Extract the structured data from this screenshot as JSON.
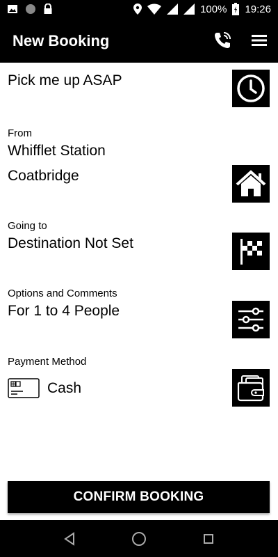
{
  "status": {
    "battery": "100%",
    "time": "19:26"
  },
  "header": {
    "title": "New Booking"
  },
  "pickup_time": {
    "value": "Pick me up ASAP"
  },
  "from": {
    "label": "From",
    "line1": "Whifflet Station",
    "line2": "Coatbridge"
  },
  "destination": {
    "label": "Going to",
    "value": "Destination Not Set"
  },
  "options": {
    "label": "Options and Comments",
    "value": "For 1 to 4 People"
  },
  "payment": {
    "label": "Payment Method",
    "value": "Cash"
  },
  "confirm": {
    "label": "CONFIRM BOOKING"
  },
  "icons": {
    "statusbar": [
      "image-icon",
      "circle-icon",
      "lock-icon",
      "location-icon",
      "wifi-icon",
      "signal-icon",
      "battery-icon"
    ],
    "header": [
      "phone-icon",
      "menu-icon"
    ],
    "rows": [
      "clock-icon",
      "home-icon",
      "checkered-flag-icon",
      "sliders-icon",
      "wallet-icon"
    ],
    "navbar": [
      "back-icon",
      "home-nav-icon",
      "recents-icon"
    ]
  }
}
